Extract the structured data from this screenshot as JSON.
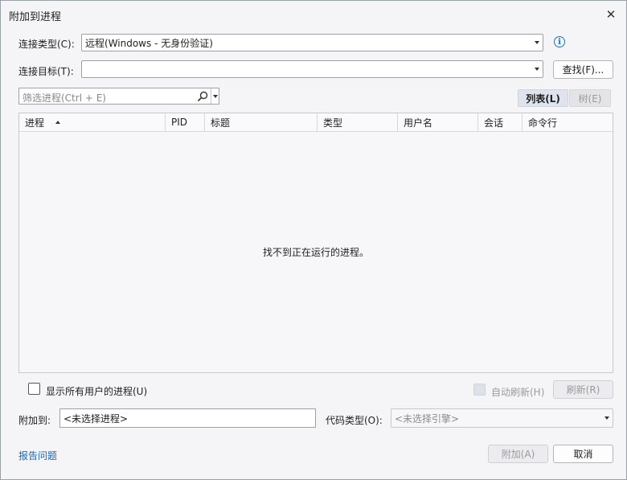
{
  "window": {
    "title": "附加到进程",
    "close_glyph": "✕"
  },
  "connection_type": {
    "label": "连接类型(C):",
    "value": "远程(Windows - 无身份验证)",
    "info_glyph": "i"
  },
  "connection_target": {
    "label": "连接目标(T):",
    "value": "",
    "find_button": "查找(F)..."
  },
  "filter": {
    "placeholder": "筛选进程(Ctrl + E)"
  },
  "view_toggle": {
    "list": "列表(L)",
    "tree": "树(E)"
  },
  "table": {
    "columns": [
      "进程",
      "PID",
      "标题",
      "类型",
      "用户名",
      "会话",
      "命令行"
    ],
    "sorted_column": "进程",
    "sort_direction": "ascending",
    "rows": [],
    "empty_message": "找不到正在运行的进程。"
  },
  "options": {
    "show_all_users": {
      "label": "显示所有用户的进程(U)",
      "checked": false
    },
    "auto_refresh": {
      "label": "自动刷新(H)",
      "enabled": false
    },
    "refresh_button": "刷新(R)"
  },
  "attach_to": {
    "label": "附加到:",
    "value": "<未选择进程>"
  },
  "code_type": {
    "label": "代码类型(O):",
    "value": "<未选择引擎>"
  },
  "footer": {
    "report_link": "报告问题",
    "attach_button": "附加(A)",
    "cancel_button": "取消"
  },
  "colors": {
    "accent": "#1a73c8",
    "link": "#1a66b8"
  }
}
